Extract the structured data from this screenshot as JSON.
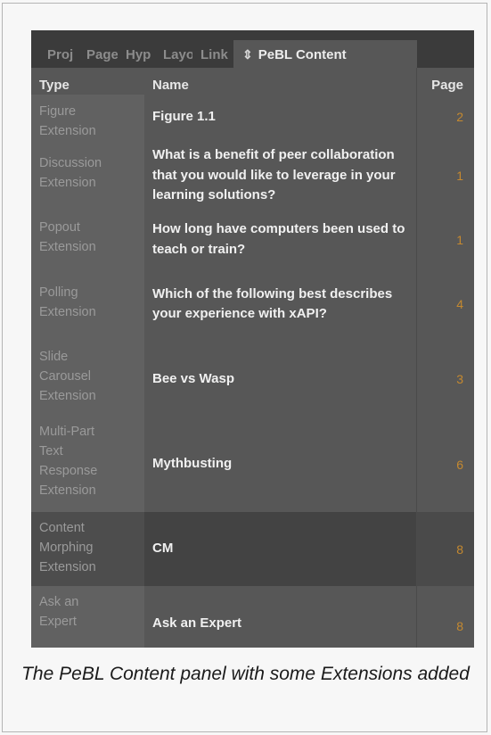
{
  "tabs": [
    {
      "label": "Proj"
    },
    {
      "label": "Page"
    },
    {
      "label": "Hyp"
    },
    {
      "label": "Layout"
    },
    {
      "label": "Link"
    },
    {
      "label": "PeBL Content"
    }
  ],
  "headers": {
    "type": "Type",
    "name": "Name",
    "page": "Page"
  },
  "rows": [
    {
      "type": "Figure\nExtension",
      "name": "Figure 1.1",
      "page": "2"
    },
    {
      "type": "Discussion\nExtension",
      "name": "What is a benefit of peer collaboration that you would like to leverage in your learning solutions?",
      "page": "1"
    },
    {
      "type": "Popout\nExtension",
      "name": "How long have computers been used to teach or train?",
      "page": "1"
    },
    {
      "type": "Polling\nExtension",
      "name": "Which of the following best describes your experience with xAPI?",
      "page": "4"
    },
    {
      "type": "Slide\nCarousel\nExtension",
      "name": "Bee vs Wasp",
      "page": "3"
    },
    {
      "type": "Multi-Part\nText\nResponse\nExtension",
      "name": "Mythbusting",
      "page": "6"
    },
    {
      "type": "Content\nMorphing\nExtension",
      "name": "CM",
      "page": "8"
    },
    {
      "type": "Ask an\nExpert",
      "name": "Ask an Expert",
      "page": "8"
    }
  ],
  "selected_row": 6,
  "caption": "The PeBL Content panel with some Extensions added",
  "colors": {
    "panel": "#575757",
    "tabbar": "#3b3b3b",
    "accent_page_number": "#c5892f"
  }
}
